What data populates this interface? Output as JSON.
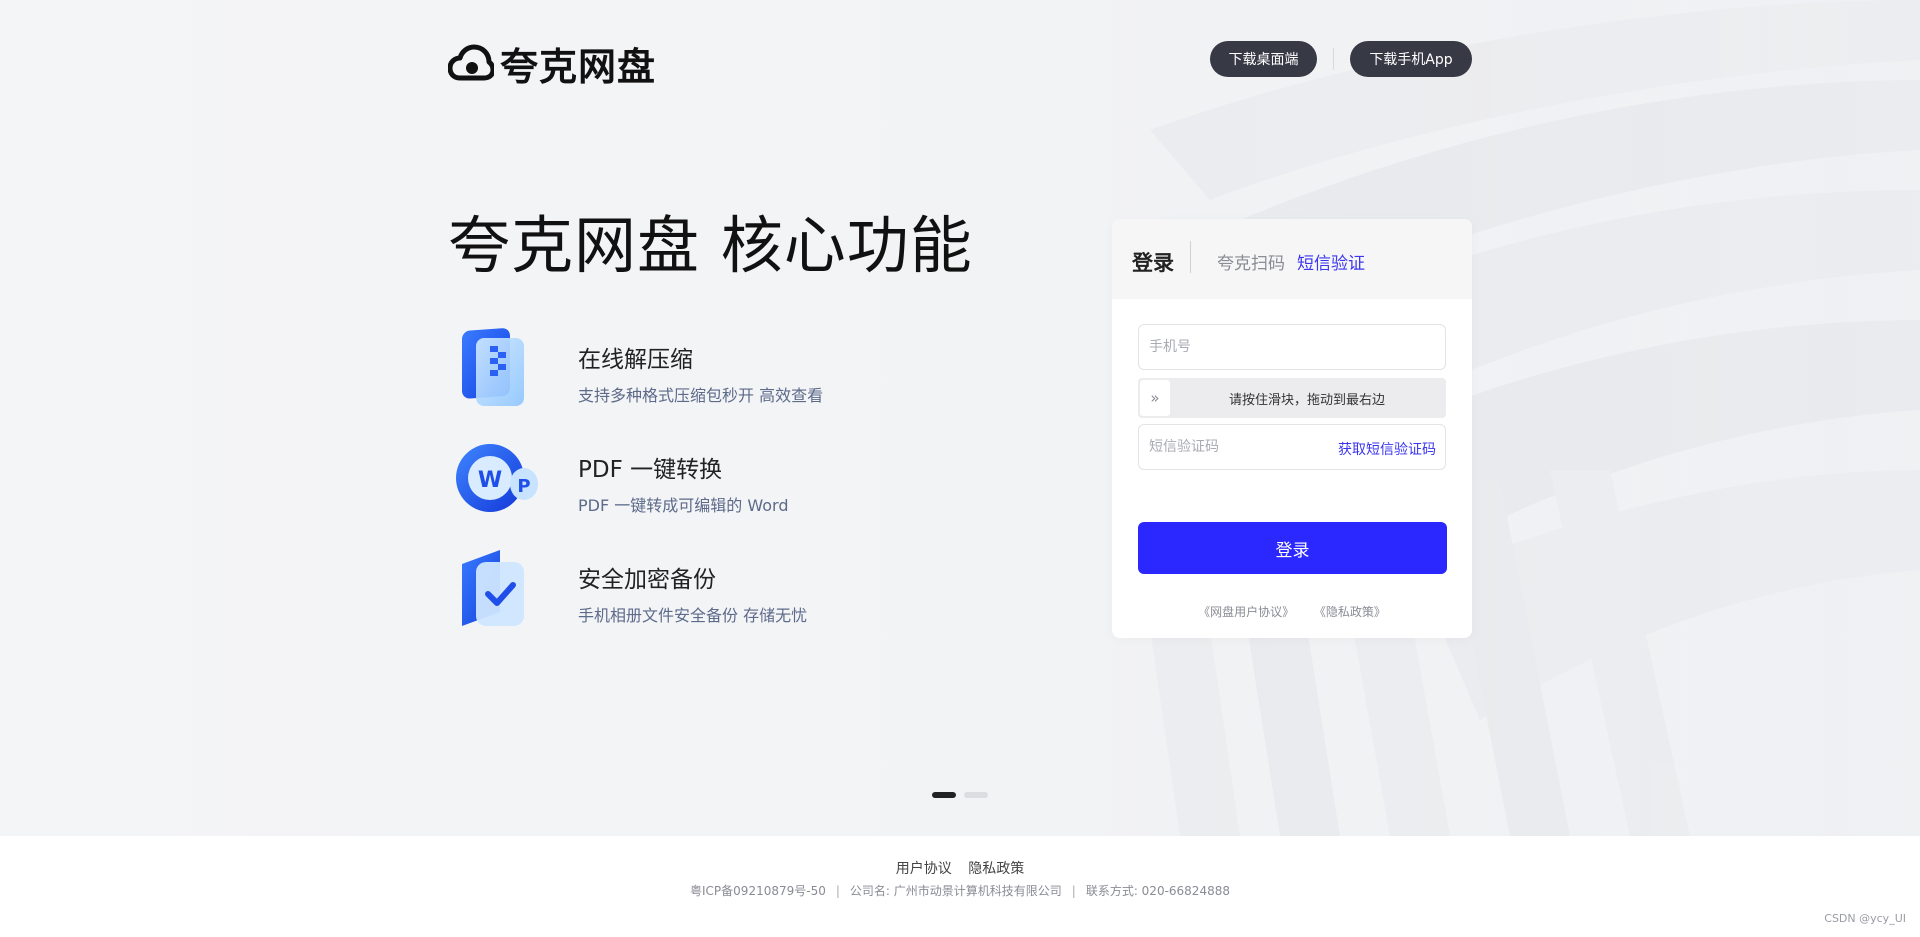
{
  "header": {
    "logo_text": "夸克网盘",
    "btn_desktop": "下载桌面端",
    "btn_mobile": "下载手机App"
  },
  "hero": {
    "headline": "夸克网盘 核心功能",
    "features": [
      {
        "title": "在线解压缩",
        "desc": "支持多种格式压缩包秒开 高效查看",
        "icon": "zip-file-icon"
      },
      {
        "title": "PDF 一键转换",
        "desc": "PDF 一键转成可编辑的 Word",
        "icon": "pdf-word-convert-icon"
      },
      {
        "title": "安全加密备份",
        "desc": "手机相册文件安全备份 存储无忧",
        "icon": "secure-backup-icon"
      }
    ],
    "carousel": {
      "count": 2,
      "active": 0
    }
  },
  "login": {
    "title": "登录",
    "tab_scan": "夸克扫码",
    "tab_sms": "短信验证",
    "phone_placeholder": "手机号",
    "slider_text": "请按住滑块，拖动到最右边",
    "slider_icon": "double-chevron-right-icon",
    "sms_placeholder": "短信验证码",
    "sms_link": "获取短信验证码",
    "submit": "登录",
    "agreement_user": "《网盘用户协议》",
    "agreement_privacy": "《隐私政策》"
  },
  "footer": {
    "link_user": "用户协议",
    "link_privacy": "隐私政策",
    "icp": "粤ICP备09210879号-50",
    "company": "公司名: 广州市动景计算机科技有限公司",
    "contact": "联系方式: 020-66824888",
    "watermark": "CSDN @ycy_UI"
  },
  "colors": {
    "accent": "#2b27ff",
    "tab_active": "#3b35f0",
    "dark_button": "#373945",
    "desc_text": "#5d6a8a"
  }
}
